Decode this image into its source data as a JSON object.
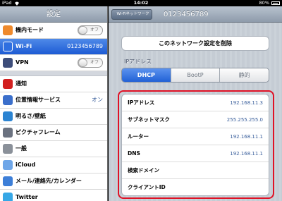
{
  "status": {
    "carrier": "iPad",
    "time": "14:02",
    "battery": "80%"
  },
  "master": {
    "title": "設定",
    "items": [
      {
        "label": "機内モード",
        "toggle": "オフ",
        "color": "#ef8a2c"
      },
      {
        "label": "Wi-Fi",
        "value": "0123456789",
        "color": "#2f6fe0",
        "selected": true
      },
      {
        "label": "VPN",
        "toggle": "オフ",
        "color": "#3d4d7a"
      },
      {
        "label": "通知",
        "color": "#d21f1f"
      },
      {
        "label": "位置情報サービス",
        "value": "オン",
        "color": "#3b6fcb"
      },
      {
        "label": "明るさ/壁紙",
        "color": "#2c84d2"
      },
      {
        "label": "ピクチャフレーム",
        "color": "#6b7280"
      },
      {
        "label": "一般",
        "color": "#8a9099"
      },
      {
        "label": "iCloud",
        "color": "#6ea6e8"
      },
      {
        "label": "メール/連絡先/カレンダー",
        "color": "#3d7fd8"
      },
      {
        "label": "Twitter",
        "color": "#36a7e6"
      }
    ]
  },
  "detail": {
    "back": "Wi-Fiネットワーク",
    "title": "0123456789",
    "forget": "このネットワーク設定を削除",
    "section": "IPアドレス",
    "segments": [
      "DHCP",
      "BootP",
      "静的"
    ],
    "active_segment": "DHCP",
    "rows": [
      {
        "key": "IPアドレス",
        "value": "192.168.11.3"
      },
      {
        "key": "サブネットマスク",
        "value": "255.255.255.0"
      },
      {
        "key": "ルーター",
        "value": "192.168.11.1"
      },
      {
        "key": "DNS",
        "value": "192.168.11.1"
      },
      {
        "key": "検索ドメイン",
        "value": ""
      },
      {
        "key": "クライアントID",
        "value": ""
      }
    ],
    "highlight_color": "#e01125"
  }
}
